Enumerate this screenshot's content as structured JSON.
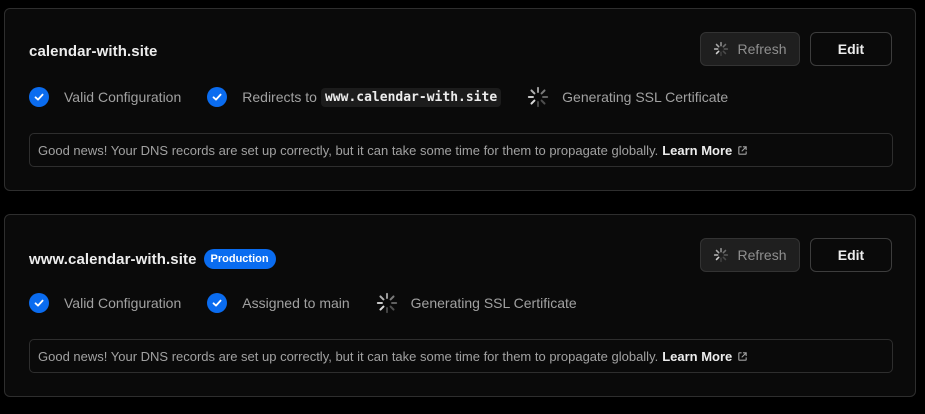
{
  "domains": [
    {
      "name": "calendar-with.site",
      "badge": "",
      "refresh_label": "Refresh",
      "edit_label": "Edit",
      "status": {
        "valid": "Valid Configuration",
        "second_prefix": "Redirects to",
        "second_code": "www.calendar-with.site",
        "ssl": "Generating SSL Certificate"
      },
      "note": {
        "text": "Good news! Your DNS records are set up correctly, but it can take some time for them to propagate globally.",
        "link": "Learn More"
      }
    },
    {
      "name": "www.calendar-with.site",
      "badge": "Production",
      "refresh_label": "Refresh",
      "edit_label": "Edit",
      "status": {
        "valid": "Valid Configuration",
        "second_prefix": "Assigned to main",
        "second_code": "",
        "ssl": "Generating SSL Certificate"
      },
      "note": {
        "text": "Good news! Your DNS records are set up correctly, but it can take some time for them to propagate globally.",
        "link": "Learn More"
      }
    }
  ],
  "colors": {
    "accent": "#0a6cf0",
    "background": "#000000",
    "card": "#0a0a0a",
    "border": "#2e2e2e"
  },
  "icons": {
    "check": "check-icon",
    "spinner": "spinner-icon",
    "external": "external-link-icon"
  }
}
